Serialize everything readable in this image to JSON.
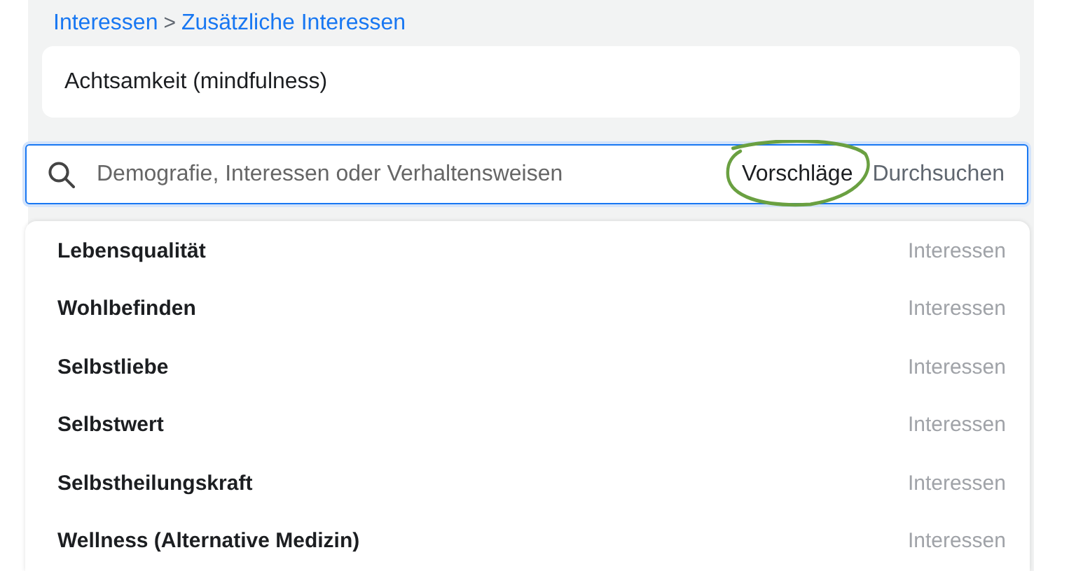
{
  "breadcrumb": {
    "items": [
      "Interessen",
      "Zusätzliche Interessen"
    ],
    "separator": ">"
  },
  "selected_interests": [
    "Achtsamkeit (mindfulness)"
  ],
  "search": {
    "placeholder": "Demografie, Interessen oder Verhaltensweisen",
    "tabs": [
      {
        "label": "Vorschläge",
        "selected": true
      },
      {
        "label": "Durchsuchen",
        "selected": false
      }
    ]
  },
  "suggestions": [
    {
      "name": "Lebensqualität",
      "category": "Interessen"
    },
    {
      "name": "Wohlbefinden",
      "category": "Interessen"
    },
    {
      "name": "Selbstliebe",
      "category": "Interessen"
    },
    {
      "name": "Selbstwert",
      "category": "Interessen"
    },
    {
      "name": "Selbstheilungskraft",
      "category": "Interessen"
    },
    {
      "name": "Wellness (Alternative Medizin)",
      "category": "Interessen"
    }
  ]
}
